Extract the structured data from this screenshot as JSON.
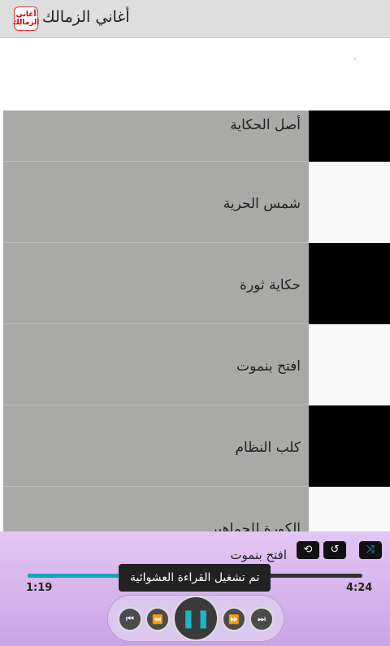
{
  "header": {
    "app_icon_text_line1": "أغاني",
    "app_icon_text_line2": "الزمالك",
    "title": "أغاني الزمالك"
  },
  "songs": [
    {
      "title": "أصل الحكاية"
    },
    {
      "title": "شمس الحرية"
    },
    {
      "title": "حكاية ثورة"
    },
    {
      "title": "افتح بنموت"
    },
    {
      "title": "كلب النظام"
    },
    {
      "title": "الكورة للجماهير"
    }
  ],
  "player": {
    "now_playing": "افتح بنموت",
    "elapsed": "1:19",
    "duration": "4:24",
    "progress_fraction": 0.3,
    "toast": "تم تشغيل القراءة العشوائية",
    "accent_color": "#17a8b9"
  },
  "colors": {
    "row_bg": "#a9aaa8",
    "side_dark": "#000000",
    "side_light": "#f7f7f7"
  }
}
